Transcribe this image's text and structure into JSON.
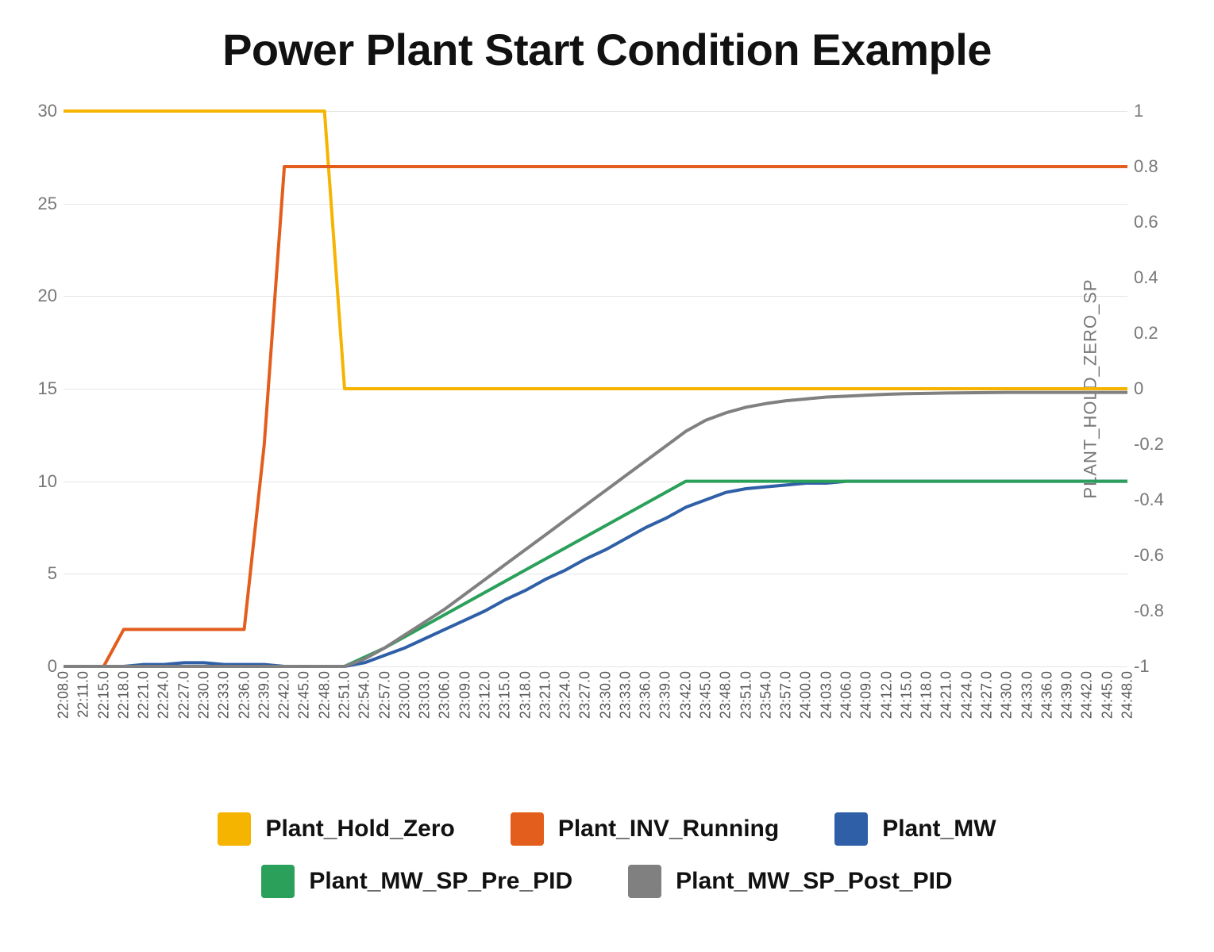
{
  "chart_data": {
    "type": "line",
    "title": "Power Plant Start Condition Example",
    "y_left": {
      "label": "",
      "ticks": [
        0,
        5,
        10,
        15,
        20,
        25,
        30
      ],
      "range": [
        0,
        30
      ]
    },
    "y_right": {
      "label": "PLANT_HOLD_ZERO_SP",
      "ticks": [
        -1,
        -0.8,
        -0.6,
        -0.4,
        -0.2,
        0,
        0.2,
        0.4,
        0.6,
        0.8,
        1
      ],
      "range": [
        -1,
        1
      ]
    },
    "x_categories": [
      "22:08.0",
      "22:11.0",
      "22:15.0",
      "22:18.0",
      "22:21.0",
      "22:24.0",
      "22:27.0",
      "22:30.0",
      "22:33.0",
      "22:36.0",
      "22:39.0",
      "22:42.0",
      "22:45.0",
      "22:48.0",
      "22:51.0",
      "22:54.0",
      "22:57.0",
      "23:00.0",
      "23:03.0",
      "23:06.0",
      "23:09.0",
      "23:12.0",
      "23:15.0",
      "23:18.0",
      "23:21.0",
      "23:24.0",
      "23:27.0",
      "23:30.0",
      "23:33.0",
      "23:36.0",
      "23:39.0",
      "23:42.0",
      "23:45.0",
      "23:48.0",
      "23:51.0",
      "23:54.0",
      "23:57.0",
      "24:00.0",
      "24:03.0",
      "24:06.0",
      "24:09.0",
      "24:12.0",
      "24:15.0",
      "24:18.0",
      "24:21.0",
      "24:24.0",
      "24:27.0",
      "24:30.0",
      "24:33.0",
      "24:36.0",
      "24:39.0",
      "24:42.0",
      "24:45.0",
      "24:48.0"
    ],
    "series": [
      {
        "name": "Plant_Hold_Zero",
        "axis": "left",
        "color": "#f5b400",
        "values": [
          30,
          30,
          30,
          30,
          30,
          30,
          30,
          30,
          30,
          30,
          30,
          30,
          30,
          30,
          15,
          15,
          15,
          15,
          15,
          15,
          15,
          15,
          15,
          15,
          15,
          15,
          15,
          15,
          15,
          15,
          15,
          15,
          15,
          15,
          15,
          15,
          15,
          15,
          15,
          15,
          15,
          15,
          15,
          15,
          15,
          15,
          15,
          15,
          15,
          15,
          15,
          15,
          15,
          15
        ]
      },
      {
        "name": "Plant_INV_Running",
        "axis": "left",
        "color": "#e35d1c",
        "values": [
          0,
          0,
          0,
          2,
          2,
          2,
          2,
          2,
          2,
          2,
          12,
          27,
          27,
          27,
          27,
          27,
          27,
          27,
          27,
          27,
          27,
          27,
          27,
          27,
          27,
          27,
          27,
          27,
          27,
          27,
          27,
          27,
          27,
          27,
          27,
          27,
          27,
          27,
          27,
          27,
          27,
          27,
          27,
          27,
          27,
          27,
          27,
          27,
          27,
          27,
          27,
          27,
          27,
          27
        ]
      },
      {
        "name": "Plant_MW",
        "axis": "left",
        "color": "#2f5fa6",
        "values": [
          0,
          0,
          0,
          0,
          0.1,
          0.1,
          0.2,
          0.2,
          0.1,
          0.1,
          0.1,
          0,
          0,
          0,
          0,
          0.2,
          0.6,
          1.0,
          1.5,
          2.0,
          2.5,
          3.0,
          3.6,
          4.1,
          4.7,
          5.2,
          5.8,
          6.3,
          6.9,
          7.5,
          8.0,
          8.6,
          9.0,
          9.4,
          9.6,
          9.7,
          9.8,
          9.9,
          9.9,
          10,
          10,
          10,
          10,
          10,
          10,
          10,
          10,
          10,
          10,
          10,
          10,
          10,
          10,
          10
        ]
      },
      {
        "name": "Plant_MW_SP_Pre_PID",
        "axis": "left",
        "color": "#2aa05a",
        "values": [
          0,
          0,
          0,
          0,
          0,
          0,
          0,
          0,
          0,
          0,
          0,
          0,
          0,
          0,
          0,
          0.5,
          1.0,
          1.6,
          2.2,
          2.8,
          3.4,
          4.0,
          4.6,
          5.2,
          5.8,
          6.4,
          7.0,
          7.6,
          8.2,
          8.8,
          9.4,
          10,
          10,
          10,
          10,
          10,
          10,
          10,
          10,
          10,
          10,
          10,
          10,
          10,
          10,
          10,
          10,
          10,
          10,
          10,
          10,
          10,
          10,
          10
        ]
      },
      {
        "name": "Plant_MW_SP_Post_PID",
        "axis": "left",
        "color": "#808080",
        "values": [
          0,
          0,
          0,
          0,
          0,
          0,
          0,
          0,
          0,
          0,
          0,
          0,
          0,
          0,
          0,
          0.4,
          1.0,
          1.7,
          2.4,
          3.1,
          3.9,
          4.7,
          5.5,
          6.3,
          7.1,
          7.9,
          8.7,
          9.5,
          10.3,
          11.1,
          11.9,
          12.7,
          13.3,
          13.7,
          14.0,
          14.2,
          14.35,
          14.45,
          14.55,
          14.6,
          14.65,
          14.7,
          14.73,
          14.75,
          14.77,
          14.78,
          14.79,
          14.8,
          14.8,
          14.8,
          14.8,
          14.8,
          14.8,
          14.8
        ]
      }
    ],
    "legend": {
      "row1": [
        "Plant_Hold_Zero",
        "Plant_INV_Running",
        "Plant_MW"
      ],
      "row2": [
        "Plant_MW_SP_Pre_PID",
        "Plant_MW_SP_Post_PID"
      ]
    }
  }
}
